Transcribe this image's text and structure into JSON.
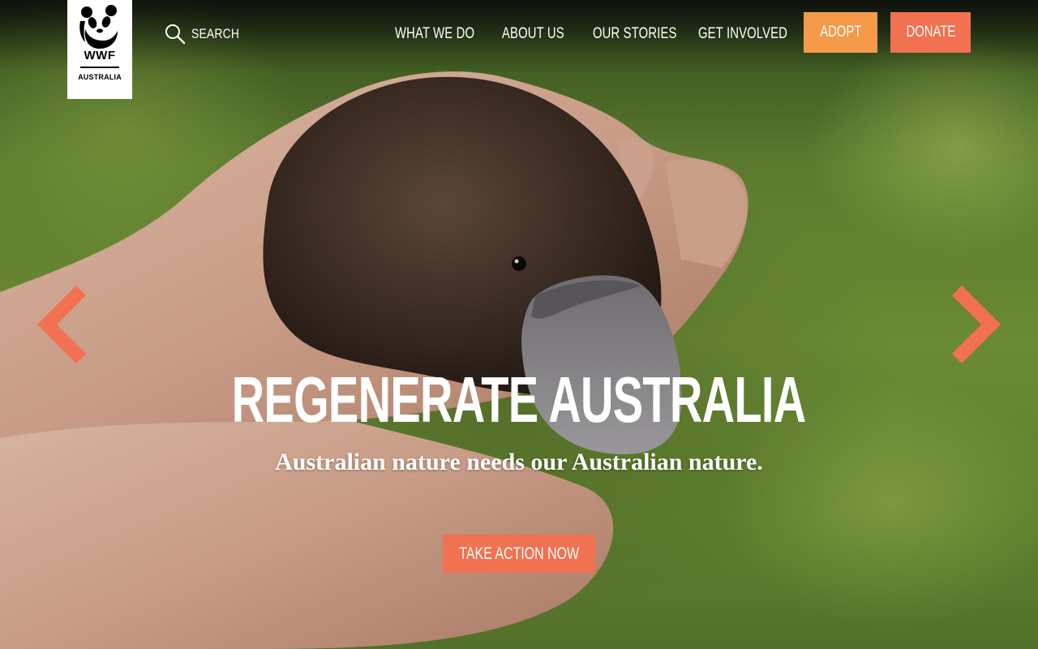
{
  "header": {
    "logo": {
      "wordmark": "WWF",
      "country": "AUSTRALIA"
    },
    "search_label": "SEARCH",
    "nav": [
      {
        "label": "WHAT WE DO"
      },
      {
        "label": "ABOUT US"
      },
      {
        "label": "OUR STORIES"
      },
      {
        "label": "GET INVOLVED"
      }
    ],
    "adopt_label": "ADOPT",
    "donate_label": "DONATE"
  },
  "hero": {
    "title": "REGENERATE AUSTRALIA",
    "subtitle": "Australian nature needs our Australian nature.",
    "cta_label": "TAKE ACTION NOW",
    "image_subject": "platypus held in hands"
  },
  "carousel": {
    "prev_icon": "chevron-left-icon",
    "next_icon": "chevron-right-icon"
  },
  "colors": {
    "adopt": "#f59a48",
    "donate": "#f27150",
    "cta": "#f27150",
    "arrow": "#f27150",
    "text": "#ffffff",
    "logo_bg": "#ffffff"
  }
}
